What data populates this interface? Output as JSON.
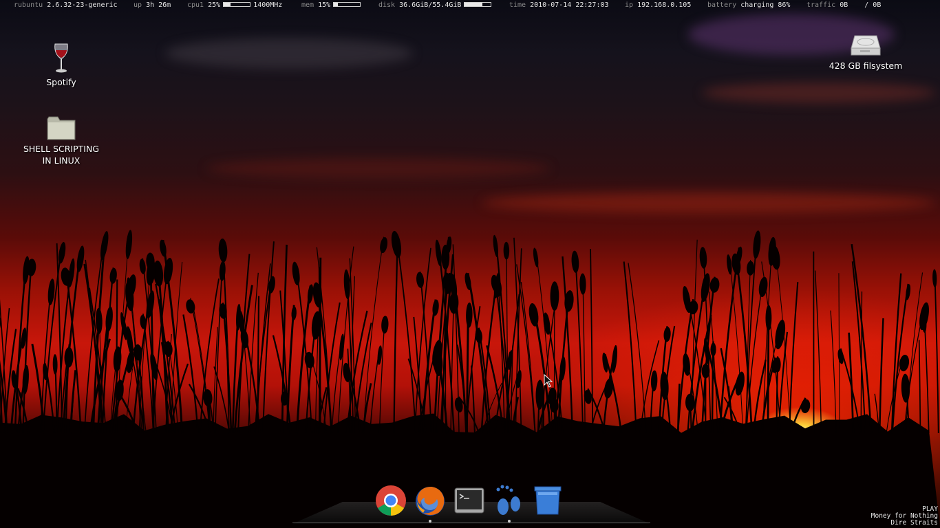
{
  "statusbar": {
    "host": "rubuntu",
    "kernel": "2.6.32-23-generic",
    "uptime_label": "up",
    "uptime": "3h 26m",
    "cpu_label": "cpu1",
    "cpu_percent": "25%",
    "cpu_fraction": 0.25,
    "cpu_freq": "1400MHz",
    "mem_label": "mem",
    "mem_percent": "15%",
    "mem_fraction": 0.15,
    "disk_label": "disk",
    "disk_usage": "36.6GiB/55.4GiB",
    "disk_fraction": 0.66,
    "time_label": "time",
    "time": "2010-07-14 22:27:03",
    "ip_label": "ip",
    "ip": "192.168.0.105",
    "battery_label": "battery",
    "battery": "charging 86%",
    "traffic_label": "traffic",
    "traffic_down": "0B",
    "traffic_up": "/ 0B"
  },
  "desktop": {
    "icons": [
      {
        "label": "Spotify",
        "icon": "wine-glass-icon"
      },
      {
        "label_line1": "SHELL SCRIPTING",
        "label_line2": "IN LINUX",
        "icon": "folder-icon"
      },
      {
        "label": "428 GB filsystem",
        "icon": "hard-drive-icon"
      }
    ]
  },
  "dock": {
    "items": [
      {
        "icon": "chrome-icon",
        "running": false
      },
      {
        "icon": "firefox-icon",
        "running": true
      },
      {
        "icon": "terminal-icon",
        "running": false
      },
      {
        "icon": "gnome-foot-icon",
        "running": true
      },
      {
        "icon": "trash-icon",
        "running": false
      }
    ]
  },
  "nowplaying": {
    "status": "PLAY",
    "title": "Money for Nothing",
    "artist": "Dire Straits"
  },
  "colors": {
    "sky_dark": "#0b0b14",
    "sunset_red": "#c8160a",
    "sun": "#ffd13a"
  }
}
